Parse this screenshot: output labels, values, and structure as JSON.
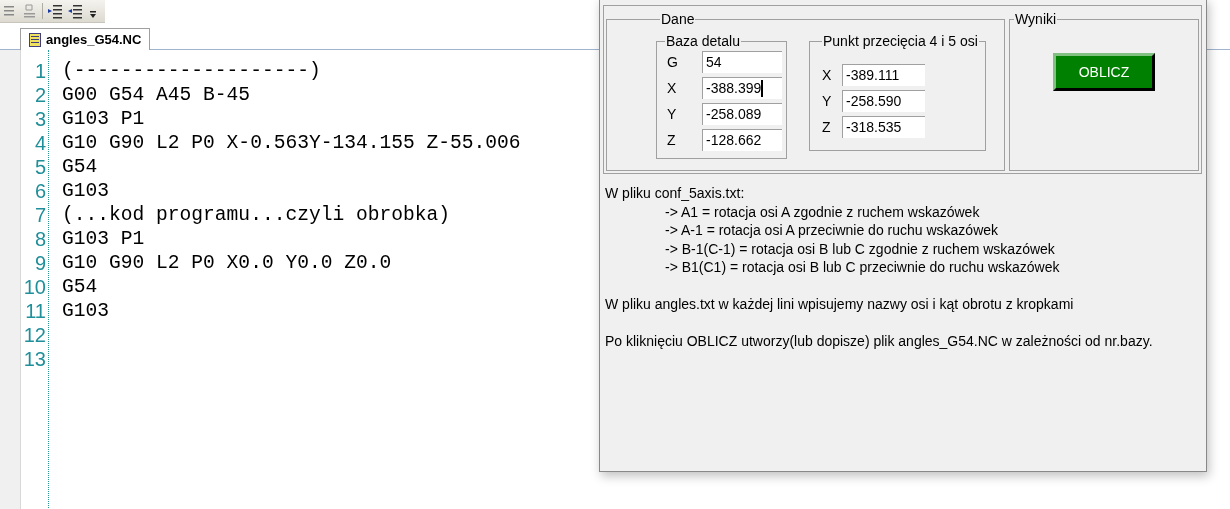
{
  "editor": {
    "tabs": [
      {
        "label": "angles_G54.NC",
        "selected": true
      }
    ],
    "lines": [
      {
        "number": "1",
        "text": "(--------------------)"
      },
      {
        "number": "2",
        "text": "G00 G54 A45 B-45"
      },
      {
        "number": "3",
        "text": "G103 P1"
      },
      {
        "number": "4",
        "text": "G10 G90 L2 P0 X-0.563Y-134.155 Z-55.006"
      },
      {
        "number": "5",
        "text": "G54"
      },
      {
        "number": "6",
        "text": "G103"
      },
      {
        "number": "7",
        "text": "(...kod programu...czyli obrobka)"
      },
      {
        "number": "8",
        "text": "G103 P1"
      },
      {
        "number": "9",
        "text": "G10 G90 L2 P0 X0.0 Y0.0 Z0.0"
      },
      {
        "number": "10",
        "text": "G54"
      },
      {
        "number": "11",
        "text": "G103"
      },
      {
        "number": "12"
      },
      {
        "number": "13"
      }
    ]
  },
  "dialog": {
    "dane": {
      "title": "Dane",
      "baza": {
        "title": "Baza detalu",
        "fields": [
          {
            "label": "G",
            "value": "54",
            "focused": false
          },
          {
            "label": "X",
            "value": "-388.399",
            "focused": true
          },
          {
            "label": "Y",
            "value": "-258.089",
            "focused": false
          },
          {
            "label": "Z",
            "value": "-128.662",
            "focused": false
          }
        ]
      },
      "punkt": {
        "title": "Punkt przecięcia 4 i 5 osi",
        "fields": [
          {
            "label": "X",
            "value": "-389.111",
            "focused": false
          },
          {
            "label": "Y",
            "value": "-258.590",
            "focused": false
          },
          {
            "label": "Z",
            "value": "-318.535",
            "focused": false
          }
        ]
      }
    },
    "wyniki": {
      "title": "Wyniki",
      "button": "OBLICZ"
    },
    "info": [
      {
        "text": "W pliku conf_5axis.txt:",
        "items": [
          "-> A1 = rotacja osi A zgodnie z ruchem wskazówek",
          "-> A-1 = rotacja osi A przeciwnie do ruchu wskazówek",
          "-> B-1(C-1) = rotacja osi B lub C zgodnie z ruchem wskazówek",
          "-> B1(C1) = rotacja osi B lub C przeciwnie do ruchu wskazówek"
        ]
      },
      {
        "text": "W pliku angles.txt w każdej lini wpisujemy nazwy osi i kąt obrotu z kropkami"
      },
      {
        "text": "Po kliknięciu OBLICZ utworzy(lub dopisze) plik angles_G54.NC w zależności od nr.bazy."
      }
    ]
  }
}
